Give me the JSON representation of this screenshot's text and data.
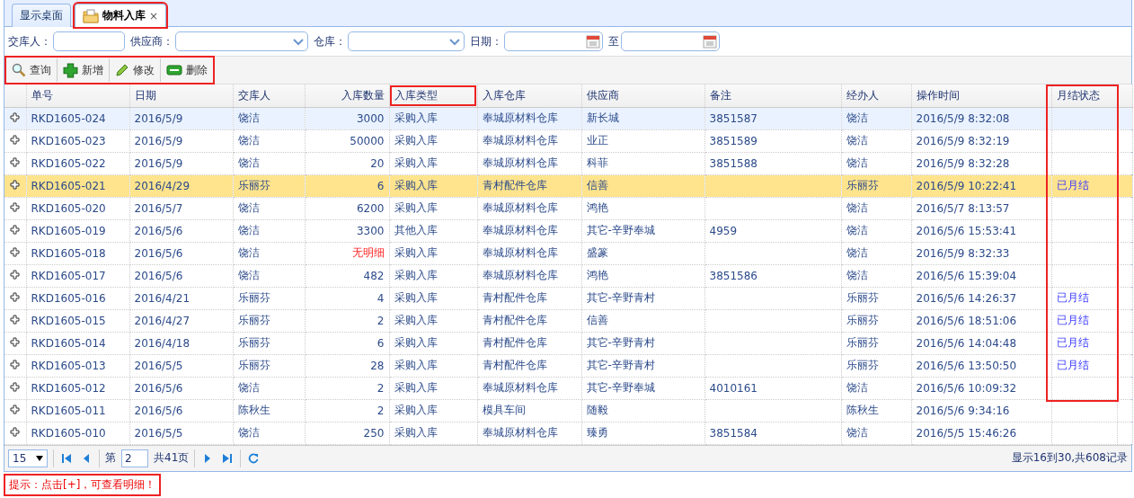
{
  "tabs": [
    {
      "label": "显示桌面",
      "selected": false,
      "kind": "home",
      "annotated": false
    },
    {
      "label": "物料入库",
      "selected": true,
      "kind": "page",
      "close": "×",
      "annotated": true
    }
  ],
  "filters": [
    {
      "label": "交库人：",
      "kind": "text"
    },
    {
      "label": "供应商：",
      "kind": "select"
    },
    {
      "label": "仓库：",
      "kind": "select"
    },
    {
      "label": "日期：",
      "kind": "date_range",
      "separator": "至"
    }
  ],
  "toolbar": {
    "annotated": true,
    "buttons": [
      {
        "label": "查询",
        "kind": "search"
      },
      {
        "label": "新增",
        "kind": "add"
      },
      {
        "label": "修改",
        "kind": "edit"
      },
      {
        "label": "删除",
        "kind": "delete"
      }
    ]
  },
  "table": {
    "columns": [
      {
        "label": "单号",
        "annotated": false
      },
      {
        "label": "日期",
        "annotated": false
      },
      {
        "label": "交库人",
        "annotated": false
      },
      {
        "label": "入库数量",
        "annotated": false
      },
      {
        "label": "入库类型",
        "annotated": true
      },
      {
        "label": "入库仓库",
        "annotated": false
      },
      {
        "label": "供应商",
        "annotated": false
      },
      {
        "label": "备注",
        "annotated": false
      },
      {
        "label": "经办人",
        "annotated": false
      },
      {
        "label": "操作时间",
        "annotated": false
      },
      {
        "label": "月结状态",
        "annotated": true
      }
    ],
    "rows": [
      {
        "selected": false,
        "hovered": true,
        "quantity_missing": false,
        "cells": [
          "RKD1605-024",
          "2016/5/9",
          "饶洁",
          "3000",
          "采购入库",
          "奉城原材料仓库",
          "新长城",
          "3851587",
          "饶洁",
          "2016/5/9 8:32:08",
          null
        ]
      },
      {
        "selected": false,
        "hovered": false,
        "quantity_missing": false,
        "cells": [
          "RKD1605-023",
          "2016/5/9",
          "饶洁",
          "50000",
          "采购入库",
          "奉城原材料仓库",
          "业正",
          "3851589",
          "饶洁",
          "2016/5/9 8:32:19",
          null
        ]
      },
      {
        "selected": false,
        "hovered": false,
        "quantity_missing": false,
        "cells": [
          "RKD1605-022",
          "2016/5/9",
          "饶洁",
          "20",
          "采购入库",
          "奉城原材料仓库",
          "科菲",
          "3851588",
          "饶洁",
          "2016/5/9 8:32:28",
          null
        ]
      },
      {
        "selected": true,
        "hovered": false,
        "quantity_missing": false,
        "cells": [
          "RKD1605-021",
          "2016/4/29",
          "乐丽芬",
          "6",
          "采购入库",
          "青村配件仓库",
          "信善",
          null,
          "乐丽芬",
          "2016/5/9 10:22:41",
          "已月结"
        ]
      },
      {
        "selected": false,
        "hovered": false,
        "quantity_missing": false,
        "cells": [
          "RKD1605-020",
          "2016/5/7",
          "饶洁",
          "6200",
          "采购入库",
          "奉城原材料仓库",
          "鸿艳",
          null,
          "饶洁",
          "2016/5/7 8:13:57",
          null
        ]
      },
      {
        "selected": false,
        "hovered": false,
        "quantity_missing": false,
        "cells": [
          "RKD1605-019",
          "2016/5/6",
          "饶洁",
          "3300",
          "其他入库",
          "奉城原材料仓库",
          "其它-辛野奉城",
          "4959",
          "饶洁",
          "2016/5/6 15:53:41",
          null
        ]
      },
      {
        "selected": false,
        "hovered": false,
        "quantity_missing": true,
        "cells": [
          "RKD1605-018",
          "2016/5/6",
          "饶洁",
          "无明细",
          "采购入库",
          "奉城原材料仓库",
          "盛篆",
          null,
          "饶洁",
          "2016/5/9 8:32:33",
          null
        ]
      },
      {
        "selected": false,
        "hovered": false,
        "quantity_missing": false,
        "cells": [
          "RKD1605-017",
          "2016/5/6",
          "饶洁",
          "482",
          "采购入库",
          "奉城原材料仓库",
          "鸿艳",
          "3851586",
          "饶洁",
          "2016/5/6 15:39:04",
          null
        ]
      },
      {
        "selected": false,
        "hovered": false,
        "quantity_missing": false,
        "cells": [
          "RKD1605-016",
          "2016/4/21",
          "乐丽芬",
          "4",
          "采购入库",
          "青村配件仓库",
          "其它-辛野青村",
          null,
          "乐丽芬",
          "2016/5/6 14:26:37",
          "已月结"
        ]
      },
      {
        "selected": false,
        "hovered": false,
        "quantity_missing": false,
        "cells": [
          "RKD1605-015",
          "2016/4/27",
          "乐丽芬",
          "2",
          "采购入库",
          "青村配件仓库",
          "信善",
          null,
          "乐丽芬",
          "2016/5/6 18:51:06",
          "已月结"
        ]
      },
      {
        "selected": false,
        "hovered": false,
        "quantity_missing": false,
        "cells": [
          "RKD1605-014",
          "2016/4/18",
          "乐丽芬",
          "6",
          "采购入库",
          "青村配件仓库",
          "其它-辛野青村",
          null,
          "乐丽芬",
          "2016/5/6 14:04:48",
          "已月结"
        ]
      },
      {
        "selected": false,
        "hovered": false,
        "quantity_missing": false,
        "cells": [
          "RKD1605-013",
          "2016/5/5",
          "乐丽芬",
          "28",
          "采购入库",
          "青村配件仓库",
          "其它-辛野青村",
          null,
          "乐丽芬",
          "2016/5/6 13:50:50",
          "已月结"
        ]
      },
      {
        "selected": false,
        "hovered": false,
        "quantity_missing": false,
        "cells": [
          "RKD1605-012",
          "2016/5/6",
          "饶洁",
          "2",
          "采购入库",
          "奉城原材料仓库",
          "其它-辛野奉城",
          "4010161",
          "饶洁",
          "2016/5/6 10:09:32",
          null
        ]
      },
      {
        "selected": false,
        "hovered": false,
        "quantity_missing": false,
        "cells": [
          "RKD1605-011",
          "2016/5/6",
          "陈秋生",
          "2",
          "采购入库",
          "模具车间",
          "随毅",
          null,
          "陈秋生",
          "2016/5/6 9:34:16",
          null
        ]
      },
      {
        "selected": false,
        "hovered": false,
        "quantity_missing": false,
        "cells": [
          "RKD1605-010",
          "2016/5/5",
          "饶洁",
          "250",
          "采购入库",
          "奉城原材料仓库",
          "臻勇",
          "3851584",
          "饶洁",
          "2016/5/5 15:46:26",
          null
        ]
      }
    ]
  },
  "pager": {
    "page_size": "15",
    "page_label": "第",
    "page": "2",
    "total_pages": "共41页",
    "summary": "显示16到30,共608记录"
  },
  "hint": {
    "text": "提示：点击[+]，可查看明细！",
    "annotated": true
  }
}
